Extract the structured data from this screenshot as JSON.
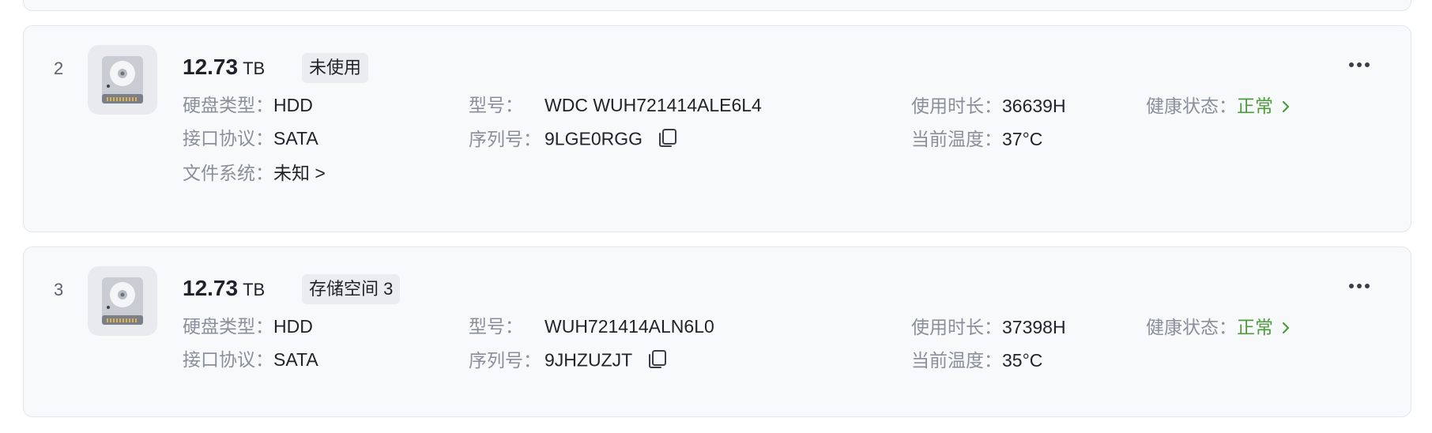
{
  "disks": [
    {
      "index": "2",
      "capacity": "12.73",
      "unit": "TB",
      "tag": "未使用",
      "type_label": "硬盘类型：",
      "type_value": "HDD",
      "model_label": "型号：",
      "model_value": "WDC WUH721414ALE6L4",
      "uptime_label": "使用时长：",
      "uptime_value": "36639H",
      "health_label": "健康状态：",
      "health_value": "正常",
      "iface_label": "接口协议：",
      "iface_value": "SATA",
      "serial_label": "序列号：",
      "serial_value": "9LGE0RGG",
      "temp_label": "当前温度：",
      "temp_value": "37°C",
      "fs_label": "文件系统：",
      "fs_value": "未知 >"
    },
    {
      "index": "3",
      "capacity": "12.73",
      "unit": "TB",
      "tag": "存储空间 3",
      "type_label": "硬盘类型：",
      "type_value": "HDD",
      "model_label": "型号：",
      "model_value": "WUH721414ALN6L0",
      "uptime_label": "使用时长：",
      "uptime_value": "37398H",
      "health_label": "健康状态：",
      "health_value": "正常",
      "iface_label": "接口协议：",
      "iface_value": "SATA",
      "serial_label": "序列号：",
      "serial_value": "9JHZUZJT",
      "temp_label": "当前温度：",
      "temp_value": "35°C"
    }
  ],
  "icons": {
    "disk": "hard-disk-icon",
    "more": "more-dots-icon",
    "copy": "copy-icon",
    "chevron": "chevron-right-icon"
  },
  "colors": {
    "health_ok": "#4e9b3c",
    "label": "#8a9099",
    "card_bg": "#f8f9fb"
  }
}
